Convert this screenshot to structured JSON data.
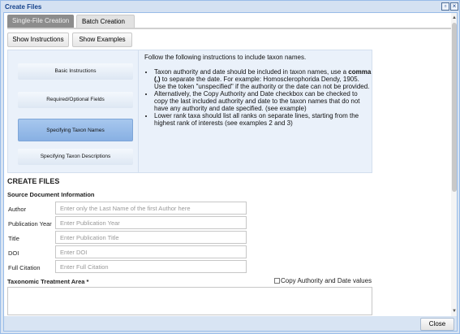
{
  "window": {
    "title": "Create Files",
    "maximize_icon": "maximize-icon",
    "close_icon": "close-icon"
  },
  "tabs": [
    {
      "label": "Single-File Creation",
      "active": false
    },
    {
      "label": "Batch Creation",
      "active": true
    }
  ],
  "toolbar": {
    "show_instructions": "Show Instructions",
    "show_examples": "Show Examples"
  },
  "instructions_menu": [
    {
      "label": "Basic Instructions",
      "selected": false
    },
    {
      "label": "Required/Optional Fields",
      "selected": false
    },
    {
      "label": "Specifying Taxon Names",
      "selected": true
    },
    {
      "label": "Specifying Taxon Descriptions",
      "selected": false
    }
  ],
  "instructions": {
    "intro": "Follow the following instructions to include taxon names.",
    "bullets": {
      "b1_pre": "Taxon authority and date should be included in taxon names, use a",
      "b1_bold": "comma (,)",
      "b1_post": "to separate the date. For example: Homosclerophorida Dendy, 1905. Use the token \"unspecified\" if the authority or the date can not be provided.",
      "b2": "Alternatively, the Copy Authority and Date checkbox can be checked to copy the last included authority and date to the taxon names that do not have any authority and date specified. (see example)",
      "b3": "Lower rank taxa should list all ranks on separate lines, starting from the highest rank of interests (see examples 2 and 3)"
    }
  },
  "form": {
    "section_title": "CREATE FILES",
    "subsection_title": "Source Document Information",
    "fields": [
      {
        "label": "Author",
        "placeholder": "Enter only the Last Name of the first Author here",
        "value": ""
      },
      {
        "label": "Publication Year",
        "placeholder": "Enter Publication Year",
        "value": ""
      },
      {
        "label": "Title",
        "placeholder": "Enter Publication Title",
        "value": ""
      },
      {
        "label": "DOI",
        "placeholder": "Enter DOI",
        "value": ""
      },
      {
        "label": "Full Citation",
        "placeholder": "Enter Full Citation",
        "value": ""
      }
    ],
    "treatment_label": "Taxonomic Treatment Area *",
    "copy_authority_label": "Copy Authority and Date values",
    "copy_authority_checked": false
  },
  "footer": {
    "close_label": "Close"
  },
  "colors": {
    "accent": "#99bce8",
    "title_text": "#15428b",
    "selected_menu": "#a7c7ee"
  }
}
